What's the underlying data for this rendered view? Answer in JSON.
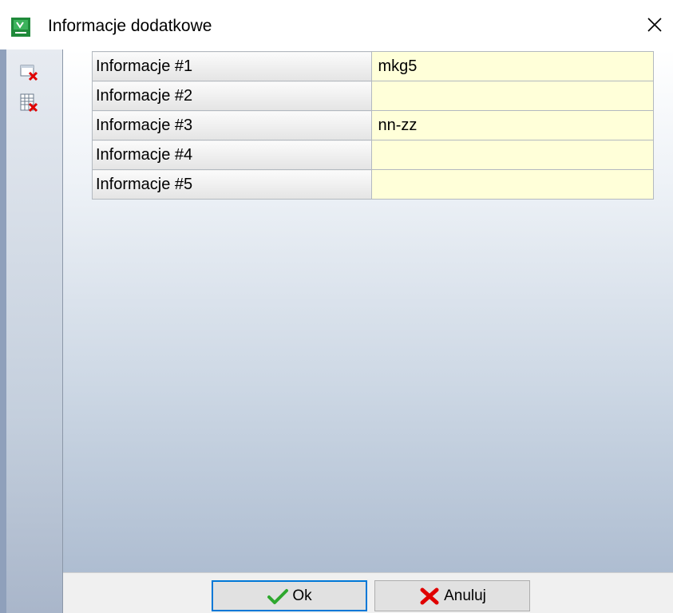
{
  "window": {
    "title": "Informacje dodatkowe"
  },
  "toolbar": {
    "buttons": [
      {
        "icon": "delete-row-icon"
      },
      {
        "icon": "delete-table-icon"
      }
    ]
  },
  "fields": [
    {
      "label": "Informacje #1",
      "value": "mkg5"
    },
    {
      "label": "Informacje #2",
      "value": ""
    },
    {
      "label": "Informacje #3",
      "value": "nn-zz"
    },
    {
      "label": "Informacje #4",
      "value": ""
    },
    {
      "label": "Informacje #5",
      "value": ""
    }
  ],
  "footer": {
    "ok_label": "Ok",
    "cancel_label": "Anuluj"
  },
  "colors": {
    "value_bg": "#ffffd9",
    "accent": "#0078d7",
    "delete_red": "#e00000",
    "ok_green": "#2ea82e"
  }
}
